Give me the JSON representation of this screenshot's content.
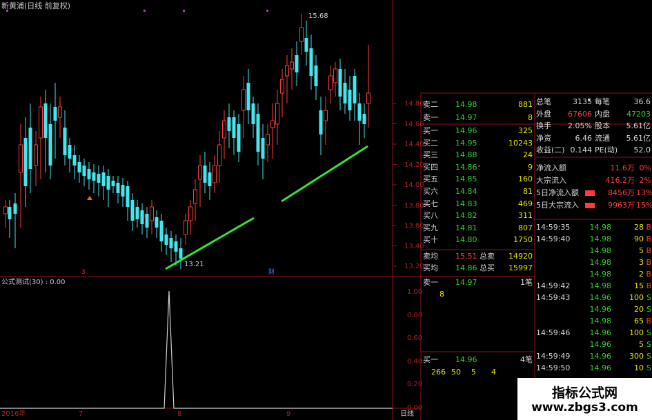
{
  "header": {
    "title": "新黄浦(日线 前复权)"
  },
  "price_axis": {
    "ticks": [
      "14.80",
      "14.60",
      "14.40",
      "14.20",
      "14.00",
      "13.80",
      "13.60",
      "13.40",
      "13.20"
    ]
  },
  "indicator_axis": {
    "ticks": [
      "1.00",
      "0.80",
      "0.60",
      "0.40",
      "0.20",
      "0.00"
    ]
  },
  "markers": {
    "high": "15.68",
    "low": "13.21",
    "label_3": "3",
    "label_ji": "财"
  },
  "indicator": {
    "title": "公式测试(30) : 0.00"
  },
  "date_axis": {
    "labels": [
      "2016年",
      "7",
      "8",
      "9"
    ],
    "period": "日线"
  },
  "order_book": {
    "sells": [
      {
        "label": "卖二",
        "price": "14.98",
        "vol": "881"
      },
      {
        "label": "卖一",
        "price": "14.97",
        "vol": "8"
      }
    ],
    "buys": [
      {
        "label": "买一",
        "price": "14.96",
        "vol": "325"
      },
      {
        "label": "买二",
        "price": "14.95",
        "vol": "10243"
      },
      {
        "label": "买三",
        "price": "14.88",
        "vol": "24"
      },
      {
        "label": "买四",
        "price": "14.86",
        "vol": "9"
      },
      {
        "label": "买五",
        "price": "14.85",
        "vol": "160"
      },
      {
        "label": "买六",
        "price": "14.84",
        "vol": "81"
      },
      {
        "label": "买七",
        "price": "14.83",
        "vol": "469"
      },
      {
        "label": "买八",
        "price": "14.82",
        "vol": "311"
      },
      {
        "label": "买九",
        "price": "14.81",
        "vol": "807"
      },
      {
        "label": "买十",
        "price": "14.80",
        "vol": "1750"
      }
    ],
    "avg_sell": {
      "label": "卖均",
      "price": "15.51",
      "tlabel": "总卖",
      "vol": "14920"
    },
    "avg_buy": {
      "label": "买均",
      "price": "14.86",
      "tlabel": "总买",
      "vol": "15997"
    },
    "queue_sell": {
      "label": "卖一",
      "price": "14.97",
      "unit": "1笔",
      "count": "8"
    },
    "queue_buy": {
      "label": "买一",
      "price": "14.96",
      "unit": "4笔",
      "counts": [
        "266",
        "50",
        "5",
        "4"
      ]
    }
  },
  "stats": {
    "rows": [
      {
        "l1": "总笔",
        "v1": "3135",
        "l2": "每笔",
        "v2": "36.6"
      },
      {
        "l1": "外盘",
        "v1": "67606",
        "l2": "内盘",
        "v2": "47203"
      },
      {
        "l1": "换手",
        "v1": "2.05%",
        "l2": "股本",
        "v2": "5.61亿"
      },
      {
        "l1": "净资",
        "v1": "6.46",
        "l2": "流通",
        "v2": "5.61亿"
      },
      {
        "l1": "收益(二)",
        "v1": "0.144",
        "l2": "PE(动)",
        "v2": "52.0"
      }
    ],
    "flows": [
      {
        "label": "净流入额",
        "value": "11.6万",
        "pct": "0%"
      },
      {
        "label": "大宗流入",
        "value": "416.2万",
        "pct": "2%"
      },
      {
        "label": "5日净流入额",
        "value": "8456万",
        "pct": "13%"
      },
      {
        "label": "5日大宗流入",
        "value": "9963万",
        "pct": "15%"
      }
    ]
  },
  "ticks": [
    {
      "time": "14:59:35",
      "price": "14.98",
      "vol": "28",
      "side": "B"
    },
    {
      "time": "14:59:40",
      "price": "14.98",
      "vol": "90",
      "side": "B"
    },
    {
      "time": "",
      "price": "14.98",
      "vol": "5",
      "side": "B"
    },
    {
      "time": "",
      "price": "14.98",
      "vol": "3",
      "side": "B"
    },
    {
      "time": "",
      "price": "14.98",
      "vol": "2",
      "side": "B"
    },
    {
      "time": "14:59:42",
      "price": "14.98",
      "vol": "15",
      "side": "B"
    },
    {
      "time": "14:59:43",
      "price": "14.96",
      "vol": "100",
      "side": "S"
    },
    {
      "time": "",
      "price": "14.96",
      "vol": "20",
      "side": "S"
    },
    {
      "time": "",
      "price": "14.98",
      "vol": "65",
      "side": "B"
    },
    {
      "time": "14:59:46",
      "price": "14.96",
      "vol": "100",
      "side": "S"
    },
    {
      "time": "",
      "price": "14.96",
      "vol": "5",
      "side": "S"
    },
    {
      "time": "14:59:49",
      "price": "14.96",
      "vol": "300",
      "side": "S"
    },
    {
      "time": "14:59:50",
      "price": "14.96",
      "vol": "10",
      "side": "S"
    }
  ],
  "watermark": {
    "title": "指标公式网",
    "url": "www.zbgs3.com"
  },
  "colors": {
    "up": "#ff3a3a",
    "down": "#44e6ee",
    "trend": "#32e632",
    "grid": "#8b1414"
  }
}
